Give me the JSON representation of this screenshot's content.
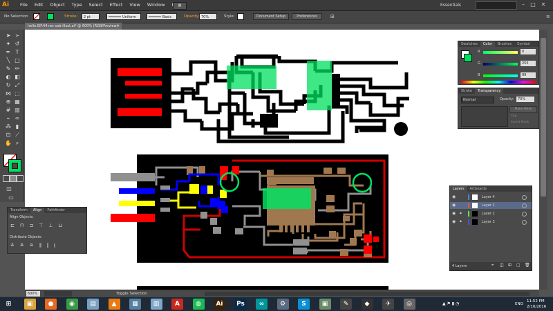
{
  "app": {
    "logo": "Ai"
  },
  "menu": [
    "File",
    "Edit",
    "Object",
    "Type",
    "Select",
    "Effect",
    "View",
    "Window",
    "Help"
  ],
  "workspace": "Essentials",
  "window_controls": {
    "minimize": "–",
    "maximize": "□",
    "close": "✕"
  },
  "control_bar": {
    "selection": "No Selection",
    "stroke_label": "Stroke:",
    "stroke_value": "2 pt",
    "profile": "Uniform",
    "brush": "Basic",
    "opacity_label": "Opacity:",
    "opacity_value": "70%",
    "style_label": "Style:",
    "document_setup": "Document Setup",
    "preferences": "Preferences"
  },
  "document_tab": {
    "title": "hello.ISP.44.res-usb-illust.ai* @ 600% (RGB/Preview)",
    "close": "✕"
  },
  "status_bar": {
    "zoom": "600%",
    "tool": "Toggle Selection"
  },
  "color_panel": {
    "tabs": [
      "Swatches",
      "Color",
      "Brushes",
      "Symbol"
    ],
    "channels": [
      {
        "label": "R",
        "value": "0"
      },
      {
        "label": "G",
        "value": "255"
      },
      {
        "label": "B",
        "value": "99"
      }
    ]
  },
  "transparency_panel": {
    "tabs": [
      "Stroke",
      "Transparency"
    ],
    "blend_mode": "Normal",
    "opacity_label": "Opacity:",
    "opacity_value": "70%",
    "make_mask": "Make Mask",
    "clip": "Clip",
    "invert_mask": "Invert Mask"
  },
  "layers_panel": {
    "tabs": [
      "Layers",
      "Artboards"
    ],
    "layers": [
      {
        "name": "Layer 4",
        "color": "#4f7fff"
      },
      {
        "name": "Layer 1",
        "color": "#ff4f4f"
      },
      {
        "name": "Layer 2",
        "color": "#4fff4f"
      },
      {
        "name": "Layer 3",
        "color": "#4f4fff"
      }
    ],
    "count": "4 Layers"
  },
  "align_panel": {
    "tabs": [
      "Transform",
      "Align",
      "Pathfinder"
    ],
    "align_objects": "Align Objects:",
    "distribute_objects": "Distribute Objects:"
  },
  "colors": {
    "accent_green": "#00e060",
    "trace_red": "#ff0000",
    "trace_yellow": "#ffff00",
    "trace_blue": "#0000ff",
    "trace_brown": "#a07850",
    "trace_gray": "#909090"
  },
  "taskbar": {
    "apps": [
      {
        "name": "start",
        "glyph": "⊞",
        "color": "#1f2a36"
      },
      {
        "name": "explorer",
        "glyph": "▣",
        "color": "#d9a441"
      },
      {
        "name": "firefox",
        "glyph": "●",
        "color": "#e66a1f"
      },
      {
        "name": "chrome",
        "glyph": "◉",
        "color": "#3b9a48"
      },
      {
        "name": "files",
        "glyph": "▤",
        "color": "#7aa0c0"
      },
      {
        "name": "vlc",
        "glyph": "▲",
        "color": "#e87a10"
      },
      {
        "name": "calculator",
        "glyph": "▦",
        "color": "#5580a0"
      },
      {
        "name": "notepad",
        "glyph": "▥",
        "color": "#7ea6c8"
      },
      {
        "name": "acrobat",
        "glyph": "A",
        "color": "#c7291f"
      },
      {
        "name": "spotify",
        "glyph": "◍",
        "color": "#1db954"
      },
      {
        "name": "illustrator",
        "glyph": "Ai",
        "color": "#3d2104"
      },
      {
        "name": "photoshop",
        "glyph": "Ps",
        "color": "#0b2a4a"
      },
      {
        "name": "arduino",
        "glyph": "∞",
        "color": "#00979c"
      },
      {
        "name": "kicad",
        "glyph": "⚙",
        "color": "#5a6a80"
      },
      {
        "name": "skype",
        "glyph": "S",
        "color": "#0a8fd5"
      },
      {
        "name": "putty",
        "glyph": "▣",
        "color": "#6a8a6a"
      },
      {
        "name": "inkscape",
        "glyph": "✎",
        "color": "#444444"
      },
      {
        "name": "inkscape2",
        "glyph": "◆",
        "color": "#333333"
      },
      {
        "name": "blender",
        "glyph": "✈",
        "color": "#444444"
      },
      {
        "name": "settings",
        "glyph": "◎",
        "color": "#666666"
      }
    ],
    "language": "ENG",
    "time": "11:52 PM",
    "date": "2/10/2016"
  }
}
